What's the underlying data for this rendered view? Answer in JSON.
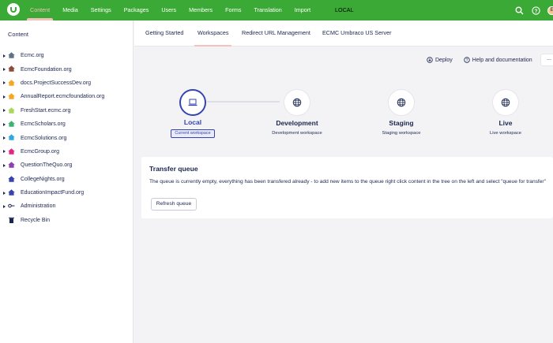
{
  "topbar": {
    "nav": [
      "Content",
      "Media",
      "Settings",
      "Packages",
      "Users",
      "Members",
      "Forms",
      "Translation",
      "Import"
    ],
    "active_index": 0,
    "environment": "LOCAL",
    "avatar_initial": "E",
    "icons": [
      "umbraco-logo-icon",
      "search-icon",
      "help-icon",
      "avatar"
    ]
  },
  "sidebar": {
    "title": "Content",
    "items": [
      {
        "label": "Ecmc.org",
        "color": "#5f7386"
      },
      {
        "label": "EcmcFoundation.org",
        "color": "#8d4b3a"
      },
      {
        "label": "docs.ProjectSuccessDev.org",
        "color": "#f5a623"
      },
      {
        "label": "AnnualReport.ecmcfoundation.org",
        "color": "#f5a623"
      },
      {
        "label": "FreshStart.ecmc.org",
        "color": "#a8d85c"
      },
      {
        "label": "EcmcScholars.org",
        "color": "#3cb371"
      },
      {
        "label": "EcmcSolutions.org",
        "color": "#33a8e0"
      },
      {
        "label": "EcmcGroup.org",
        "color": "#e5257f"
      },
      {
        "label": "QuestionTheQuo.org",
        "color": "#8b3fb3"
      },
      {
        "label": "CollegeNights.org",
        "color": "#3544b1"
      },
      {
        "label": "EducationImpactFund.org",
        "color": "#3544b1"
      },
      {
        "label": "Administration",
        "color": "#1b264f"
      },
      {
        "label": "Recycle Bin",
        "color": "#1b264f"
      }
    ]
  },
  "tabs": [
    "Getting Started",
    "Workspaces",
    "Redirect URL Management",
    "ECMC Umbraco US Server"
  ],
  "active_tab": 1,
  "actions": {
    "deploy": "Deploy",
    "help": "Help and documentation",
    "more": "..."
  },
  "workflow": [
    {
      "title": "Local",
      "badge": "Current workspace",
      "icon": "laptop-icon"
    },
    {
      "title": "Development",
      "subtitle": "Development workspace",
      "icon": "globe-icon"
    },
    {
      "title": "Staging",
      "subtitle": "Staging workspace",
      "icon": "globe-icon"
    },
    {
      "title": "Live",
      "subtitle": "Live workspace",
      "icon": "globe-icon"
    }
  ],
  "queue": {
    "title": "Transfer queue",
    "text": "The queue is currently empty, everything has been transfered already - to add new items to the queue right click content in the tree on the left and select \"queue for transfer\"",
    "button": "Refresh queue"
  },
  "colors": {
    "topbar": "#3ba935",
    "active_nav": "#f5c1bc",
    "primary": "#3544b1",
    "text": "#1b264f"
  }
}
